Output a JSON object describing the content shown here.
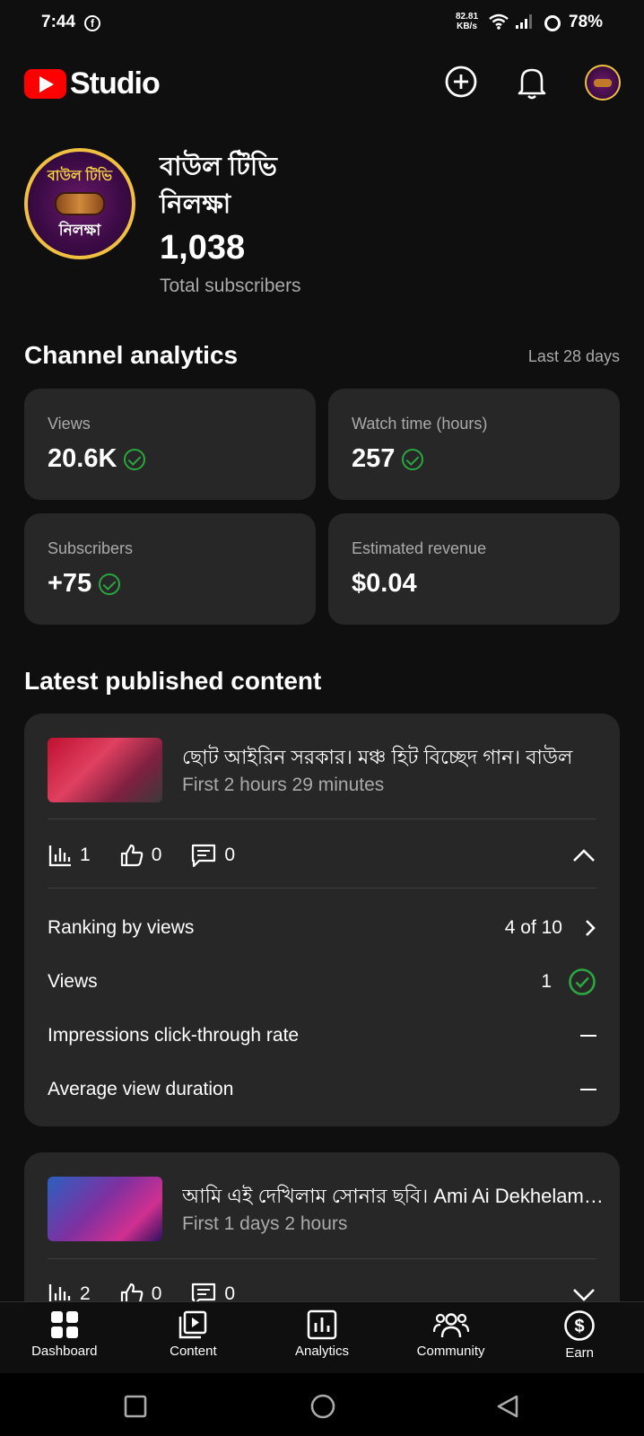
{
  "status_bar": {
    "time": "7:44",
    "net_speed_value": "82.81",
    "net_speed_unit": "KB/s",
    "battery": "78%"
  },
  "header": {
    "app_name": "Studio",
    "brand_color": "#ff0000"
  },
  "channel": {
    "name_line1": "বাউল টিভি",
    "name_line2": "নিলক্ষা",
    "subscriber_count": "1,038",
    "subscriber_label": "Total subscribers",
    "avatar_top_text": "বাউল টিভি",
    "avatar_bottom_text": "নিলক্ষা"
  },
  "analytics": {
    "title": "Channel analytics",
    "range": "Last 28 days",
    "metrics": [
      {
        "label": "Views",
        "value": "20.6K",
        "verified": true
      },
      {
        "label": "Watch time (hours)",
        "value": "257",
        "verified": true
      },
      {
        "label": "Subscribers",
        "value": "+75",
        "verified": true
      },
      {
        "label": "Estimated revenue",
        "value": "$0.04",
        "verified": false
      }
    ]
  },
  "latest": {
    "title": "Latest published content",
    "items": [
      {
        "title": "ছোট আইরিন সরকার। মঞ্চ হিট বিচ্ছেদ গান। বাউল",
        "subtitle": "First 2 hours 29 minutes",
        "views": "1",
        "likes": "0",
        "comments": "0",
        "expanded": true,
        "details": [
          {
            "label": "Ranking by views",
            "value": "4 of 10"
          },
          {
            "label": "Views",
            "value": "1"
          },
          {
            "label": "Impressions click-through rate",
            "value": ""
          },
          {
            "label": "Average view duration",
            "value": ""
          }
        ]
      },
      {
        "title": "আমি এই দেখিলাম সোনার ছবি। Ami Ai Dekhelam Sonar Chobi",
        "subtitle": "First 1 days 2 hours",
        "views": "2",
        "likes": "0",
        "comments": "0",
        "expanded": false
      }
    ]
  },
  "bottom_nav": {
    "items": [
      {
        "label": "Dashboard",
        "icon": "dashboard-icon",
        "active": true
      },
      {
        "label": "Content",
        "icon": "content-icon",
        "active": false
      },
      {
        "label": "Analytics",
        "icon": "analytics-icon",
        "active": false
      },
      {
        "label": "Community",
        "icon": "community-icon",
        "active": false
      },
      {
        "label": "Earn",
        "icon": "earn-icon",
        "active": false
      }
    ]
  },
  "colors": {
    "background": "#0f0f0f",
    "card": "#272727",
    "check_green": "#2ba640",
    "muted_text": "#aaaaaa"
  }
}
